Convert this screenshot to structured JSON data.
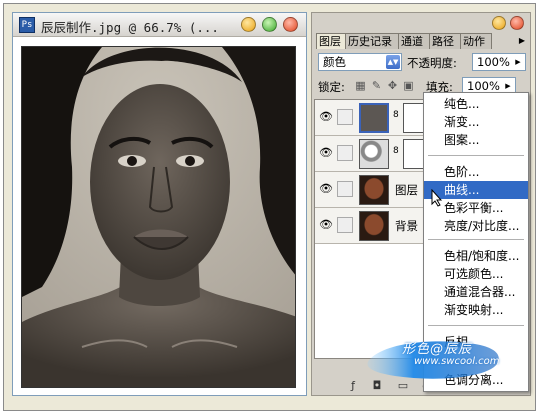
{
  "document": {
    "title": "辰辰制作.jpg @ 66.7% (..."
  },
  "panel": {
    "tabs": [
      "图层",
      "历史记录",
      "通道",
      "路径",
      "动作"
    ],
    "blend_mode": "颜色",
    "opacity_label": "不透明度:",
    "opacity_value": "100%",
    "lock_label": "锁定:",
    "fill_label": "填充:",
    "fill_value": "100%",
    "layers": [
      {
        "name": "",
        "type": "adjustment",
        "selected": true
      },
      {
        "name": "",
        "type": "adjustment",
        "selected": false
      },
      {
        "name": "图层",
        "type": "image",
        "selected": false
      },
      {
        "name": "背景",
        "type": "image",
        "selected": false
      }
    ]
  },
  "menu": {
    "groups": [
      [
        "纯色...",
        "渐变...",
        "图案..."
      ],
      [
        "色阶...",
        "曲线...",
        "色彩平衡...",
        "亮度/对比度..."
      ],
      [
        "色相/饱和度...",
        "可选颜色...",
        "通道混合器...",
        "渐变映射..."
      ],
      [
        "反相",
        "色调分离..."
      ]
    ],
    "highlighted": "曲线..."
  },
  "watermark": {
    "line1": "形色@辰辰",
    "line2": "www.swcool.com"
  },
  "colors": {
    "menu_highlight": "#316ac5",
    "panel_bg": "#d4d0c8",
    "selected_layer": "#3a62b8"
  }
}
